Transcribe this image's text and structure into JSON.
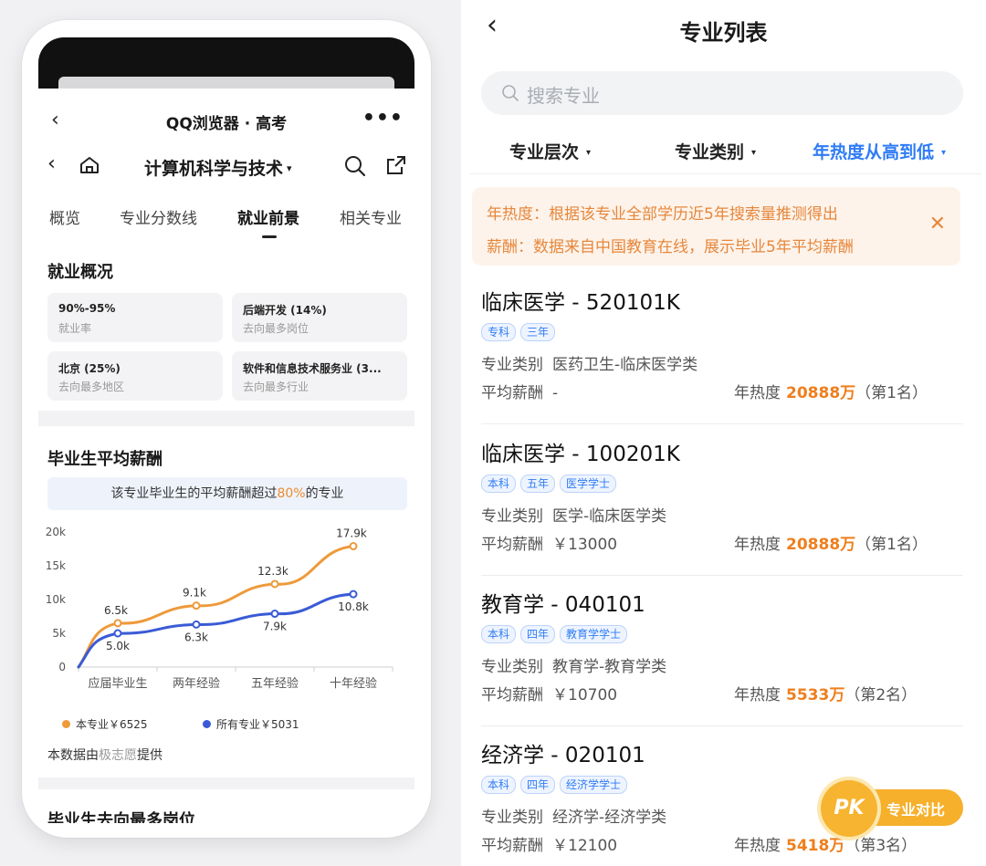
{
  "left": {
    "app_title": "QQ浏览器 · 高考",
    "more": "•••",
    "back": "‹",
    "major_title": "计算机科学与技术",
    "caret": "▾",
    "tabs": [
      {
        "label": "概览"
      },
      {
        "label": "专业分数线"
      },
      {
        "label": "就业前景"
      },
      {
        "label": "相关专业"
      }
    ],
    "employment": {
      "title": "就业概况",
      "stats": [
        {
          "value": "90%-95%",
          "label": "就业率"
        },
        {
          "value": "后端开发 (14%)",
          "label": "去向最多岗位"
        },
        {
          "value": "北京 (25%)",
          "label": "去向最多地区"
        },
        {
          "value": "软件和信息技术服务业 (3...",
          "label": "去向最多行业"
        }
      ]
    },
    "salary": {
      "title": "毕业生平均薪酬",
      "banner_pre": "该专业毕业生的平均薪酬超过",
      "banner_pct": "80%",
      "banner_post": "的专业",
      "legend_major": "本专业￥6525",
      "legend_all": "所有专业￥5031",
      "source_pre": "本数据由",
      "source_name": "极志愿",
      "source_post": "提供"
    },
    "next_title": "毕业生去向最多岗位"
  },
  "chart_data": {
    "type": "line",
    "categories": [
      "应届毕业生",
      "两年经验",
      "五年经验",
      "十年经验"
    ],
    "y_ticks": [
      "0",
      "5k",
      "10k",
      "15k",
      "20k"
    ],
    "ylim": [
      0,
      20000
    ],
    "series": [
      {
        "name": "本专业￥6525",
        "color": "#ee9a3a",
        "values": [
          6500,
          9100,
          12300,
          17900
        ],
        "labels": [
          "6.5k",
          "9.1k",
          "12.3k",
          "17.9k"
        ]
      },
      {
        "name": "所有专业￥5031",
        "color": "#3a5bd6",
        "values": [
          5000,
          6300,
          7900,
          10800
        ],
        "labels": [
          "5.0k",
          "6.3k",
          "7.9k",
          "10.8k"
        ]
      }
    ],
    "grid": false
  },
  "right": {
    "back": "‹",
    "title": "专业列表",
    "search_placeholder": "搜索专业",
    "filters": [
      {
        "label": "专业层次"
      },
      {
        "label": "专业类别"
      },
      {
        "label": "年热度从高到低"
      }
    ],
    "filter_caret": "▾",
    "notice": [
      "年热度：根据该专业全部学历近5年搜索量推测得出",
      "薪酬：数据来自中国教育在线，展示毕业5年平均薪酬"
    ],
    "notice_close": "✕",
    "items": [
      {
        "title": "临床医学 - 520101K",
        "tags": [
          "专科",
          "三年"
        ],
        "category_label": "专业类别",
        "category": "医药卫生-临床医学类",
        "salary_label": "平均薪酬",
        "salary": "-",
        "heat_label": "年热度",
        "heat": "20888万",
        "rank": "（第1名）"
      },
      {
        "title": "临床医学 - 100201K",
        "tags": [
          "本科",
          "五年",
          "医学学士"
        ],
        "category_label": "专业类别",
        "category": "医学-临床医学类",
        "salary_label": "平均薪酬",
        "salary": "￥13000",
        "heat_label": "年热度",
        "heat": "20888万",
        "rank": "（第1名）"
      },
      {
        "title": "教育学 - 040101",
        "tags": [
          "本科",
          "四年",
          "教育学学士"
        ],
        "category_label": "专业类别",
        "category": "教育学-教育学类",
        "salary_label": "平均薪酬",
        "salary": "￥10700",
        "heat_label": "年热度",
        "heat": "5533万",
        "rank": "（第2名）"
      },
      {
        "title": "经济学 - 020101",
        "tags": [
          "本科",
          "四年",
          "经济学学士"
        ],
        "category_label": "专业类别",
        "category": "经济学-经济学类",
        "salary_label": "平均薪酬",
        "salary": "￥12100",
        "heat_label": "年热度",
        "heat": "5418万",
        "rank": "（第3名）"
      }
    ],
    "pk": {
      "logo": "PK",
      "label": "专业对比"
    }
  },
  "colors": {
    "accent_blue": "#2f7cf6",
    "accent_orange": "#ee7f1d",
    "notice_bg": "#fdf3ea"
  }
}
